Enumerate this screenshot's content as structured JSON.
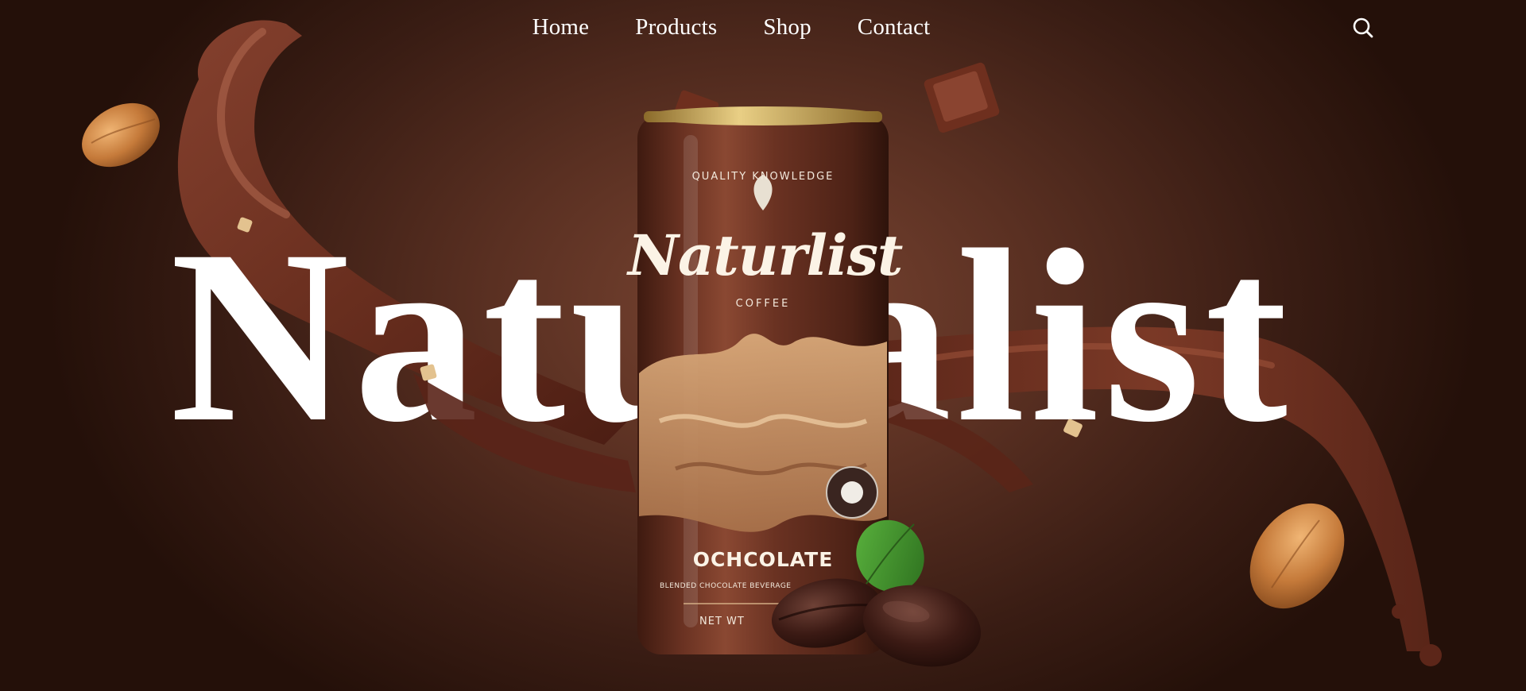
{
  "nav": {
    "links": [
      {
        "label": "Home"
      },
      {
        "label": "Products"
      },
      {
        "label": "Shop"
      },
      {
        "label": "Contact"
      }
    ],
    "search_icon": "search-icon"
  },
  "hero": {
    "title": "Naturalist"
  },
  "product": {
    "brand": "Naturlist",
    "top_text": "QUALITY KNOWLEDGE",
    "sub_text": "COFFEE",
    "flavor": "OCHCOLATE",
    "small_text": "BLENDED CHOCOLATE BEVERAGE",
    "bottom_text": "NET WT"
  },
  "colors": {
    "background": "#3a1d14",
    "chocolate": "#6b3222",
    "can": "#5a2a1c",
    "cream": "#c99a6b",
    "gold": "#c9a24a",
    "text": "#ffffff"
  }
}
